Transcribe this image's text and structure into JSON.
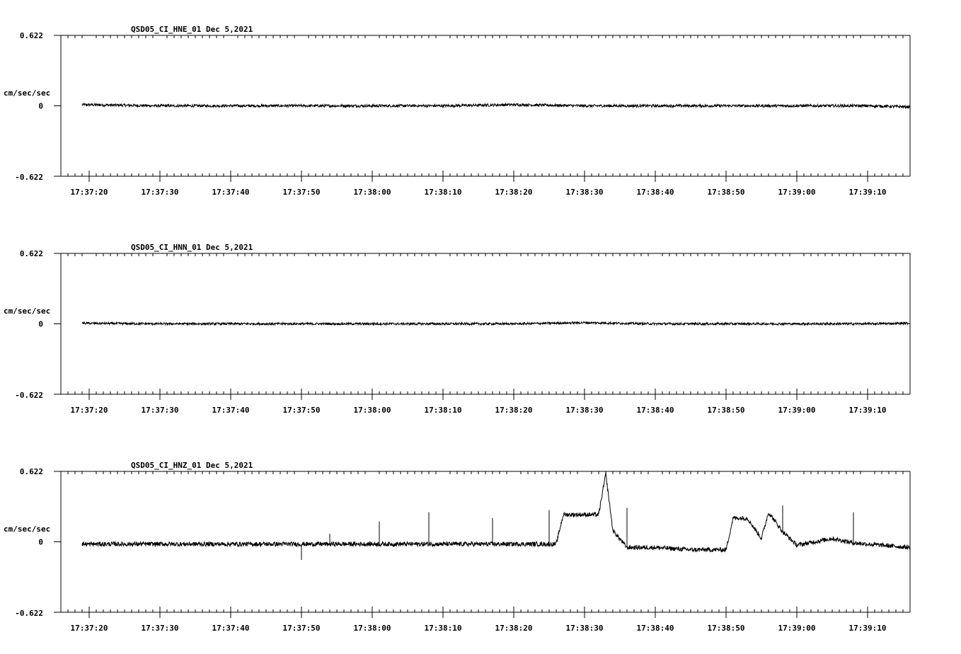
{
  "chart_data": [
    {
      "type": "line",
      "title": "QSD05_CI_HNE_01  Dec 5,2021",
      "ylabel": "cm/sec/sec",
      "ylim": [
        -0.622,
        0.622
      ],
      "ytick_labels": [
        "0.622",
        "0",
        "-0.622"
      ],
      "xtick_labels": [
        "17:37:20",
        "17:37:30",
        "17:37:40",
        "17:37:50",
        "17:38:00",
        "17:38:10",
        "17:38:20",
        "17:38:30",
        "17:38:40",
        "17:38:50",
        "17:39:00",
        "17:39:10"
      ],
      "series": [
        {
          "x": [
            "17:37:19",
            "17:37:30",
            "17:37:40",
            "17:37:50",
            "17:38:00",
            "17:38:10",
            "17:38:20",
            "17:38:30",
            "17:38:40",
            "17:38:50",
            "17:39:00",
            "17:39:10",
            "17:39:16"
          ],
          "values": [
            0.01,
            0.0,
            0.0,
            0.0,
            0.0,
            0.0,
            0.01,
            0.0,
            0.0,
            0.0,
            0.0,
            0.0,
            -0.01
          ],
          "noise": 0.012
        }
      ]
    },
    {
      "type": "line",
      "title": "QSD05_CI_HNN_01  Dec 5,2021",
      "ylabel": "cm/sec/sec",
      "ylim": [
        -0.622,
        0.622
      ],
      "ytick_labels": [
        "0.622",
        "0",
        "-0.622"
      ],
      "xtick_labels": [
        "17:37:20",
        "17:37:30",
        "17:37:40",
        "17:37:50",
        "17:38:00",
        "17:38:10",
        "17:38:20",
        "17:38:30",
        "17:38:40",
        "17:38:50",
        "17:39:00",
        "17:39:10"
      ],
      "series": [
        {
          "x": [
            "17:37:19",
            "17:37:30",
            "17:37:40",
            "17:37:50",
            "17:38:00",
            "17:38:10",
            "17:38:20",
            "17:38:30",
            "17:38:40",
            "17:38:50",
            "17:39:00",
            "17:39:10",
            "17:39:16"
          ],
          "values": [
            0.005,
            0.0,
            0.0,
            0.0,
            0.0,
            0.0,
            0.0,
            0.01,
            0.0,
            0.0,
            0.0,
            0.0,
            0.005
          ],
          "noise": 0.01
        }
      ]
    },
    {
      "type": "line",
      "title": "QSD05_CI_HNZ_01  Dec 5,2021",
      "ylabel": "cm/sec/sec",
      "ylim": [
        -0.622,
        0.622
      ],
      "ytick_labels": [
        "0.622",
        "0",
        "-0.622"
      ],
      "xtick_labels": [
        "17:37:20",
        "17:37:30",
        "17:37:40",
        "17:37:50",
        "17:38:00",
        "17:38:10",
        "17:38:20",
        "17:38:30",
        "17:38:40",
        "17:38:50",
        "17:39:00",
        "17:39:10"
      ],
      "series": [
        {
          "x": [
            "17:37:19",
            "17:37:25",
            "17:37:35",
            "17:37:45",
            "17:37:55",
            "17:38:05",
            "17:38:15",
            "17:38:24",
            "17:38:26",
            "17:38:27",
            "17:38:32",
            "17:38:33",
            "17:38:34",
            "17:38:36",
            "17:38:40",
            "17:38:45",
            "17:38:47",
            "17:38:50",
            "17:38:51",
            "17:38:53",
            "17:38:55",
            "17:38:56",
            "17:38:58",
            "17:39:00",
            "17:39:05",
            "17:39:08",
            "17:39:12",
            "17:39:16"
          ],
          "values": [
            -0.02,
            -0.02,
            -0.02,
            -0.02,
            -0.02,
            -0.02,
            -0.02,
            -0.02,
            -0.02,
            0.24,
            0.24,
            0.6,
            0.1,
            -0.05,
            -0.05,
            -0.07,
            -0.07,
            -0.07,
            0.21,
            0.21,
            0.03,
            0.26,
            0.09,
            -0.03,
            0.03,
            -0.01,
            -0.03,
            -0.05
          ],
          "noise": 0.02,
          "spikes": [
            {
              "x": "17:37:50",
              "value": -0.16
            },
            {
              "x": "17:37:54",
              "value": 0.07
            },
            {
              "x": "17:38:01",
              "value": 0.18
            },
            {
              "x": "17:38:08",
              "value": 0.26
            },
            {
              "x": "17:38:17",
              "value": 0.21
            },
            {
              "x": "17:38:25",
              "value": 0.28
            },
            {
              "x": "17:38:36",
              "value": 0.3
            },
            {
              "x": "17:39:08",
              "value": 0.26
            },
            {
              "x": "17:38:58",
              "value": 0.32
            }
          ]
        }
      ]
    }
  ]
}
